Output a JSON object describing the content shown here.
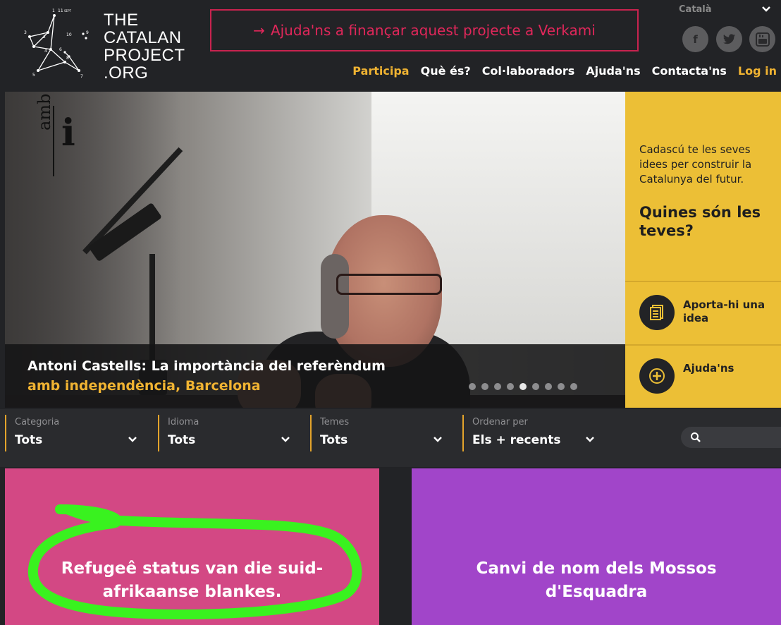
{
  "header": {
    "logo_lines": [
      "THE",
      "CATALAN",
      "PROJECT",
      ".ORG"
    ],
    "logo_numbers": [
      "1",
      "11",
      "SEPT",
      "2",
      "3",
      "10",
      "4",
      "6",
      "8",
      "5",
      "7",
      "9"
    ],
    "cta_arrow": "→",
    "cta_label": "Ajuda'ns a finançar aquest projecte a Verkami",
    "language": "Català",
    "social": [
      {
        "icon": "facebook-icon",
        "glyph": "f"
      },
      {
        "icon": "twitter-icon",
        "glyph": "t"
      },
      {
        "icon": "youtube-icon",
        "glyph": "You"
      }
    ],
    "nav": [
      {
        "label": "Participa",
        "color": "#f0b332"
      },
      {
        "label": "Què és?",
        "color": "#ffffff"
      },
      {
        "label": "Col·laboradors",
        "color": "#ffffff"
      },
      {
        "label": "Ajuda'ns",
        "color": "#ffffff"
      },
      {
        "label": "Contacta'ns",
        "color": "#ffffff"
      },
      {
        "label": "Log in",
        "color": "#f0b332"
      }
    ]
  },
  "hero": {
    "brand_word": "amb",
    "brand_letter": "i",
    "caption_line1": "Antoni Castells: La importància del referèndum",
    "caption_line2": "amb independència, Barcelona",
    "slide_count": 9,
    "active_slide": 5
  },
  "side_panel": {
    "text": "Cadascú te les seves idees per construir la Catalunya del futur.",
    "heading": "Quines són les teves?",
    "btn1_label": "Aporta-hi una idea",
    "btn2_label": "Ajuda'ns"
  },
  "filters": [
    {
      "label": "Categoria",
      "value": "Tots"
    },
    {
      "label": "Idioma",
      "value": "Tots"
    },
    {
      "label": "Temes",
      "value": "Tots"
    },
    {
      "label": "Ordenar per",
      "value": "Els + recents"
    }
  ],
  "search": {
    "placeholder": ""
  },
  "cards": [
    {
      "title": "Refugeê status van die suid-afrikaanse blankes.",
      "color": "#d34884"
    },
    {
      "title": "Canvi de nom dels Mossos d'Esquadra",
      "color": "#a145c9"
    }
  ],
  "colors": {
    "accent_yellow": "#f0b332",
    "cta_red": "#e0275a",
    "highlight_green": "#39f21f"
  }
}
